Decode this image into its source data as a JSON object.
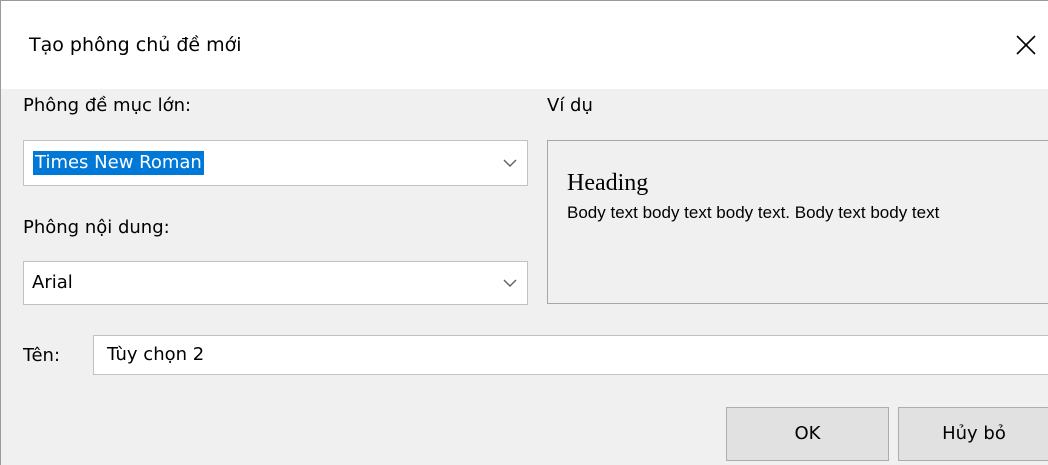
{
  "dialog": {
    "title": "Tạo phông chủ đề mới",
    "close_icon": "close-icon"
  },
  "heading_font": {
    "label": "Phông đề mục lớn:",
    "value": "Times New Roman"
  },
  "body_font": {
    "label": "Phông nội dung:",
    "value": "Arial"
  },
  "sample": {
    "label": "Ví dụ",
    "heading": "Heading",
    "body": "Body text body text body text. Body text body text"
  },
  "name": {
    "label": "Tên:",
    "value": "Tùy chọn 2"
  },
  "buttons": {
    "ok": "OK",
    "cancel": "Hủy bỏ"
  },
  "colors": {
    "selection": "#0078d7",
    "background": "#f0f0f0"
  }
}
